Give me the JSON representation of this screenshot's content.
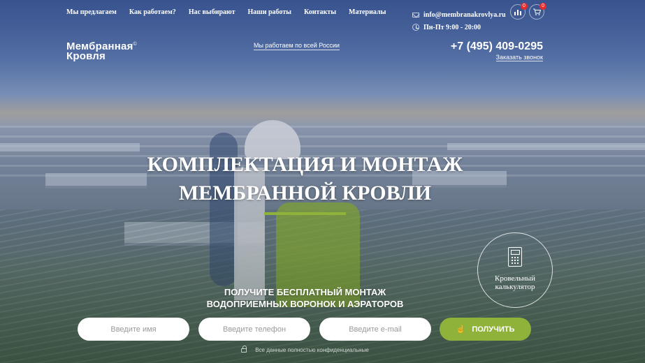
{
  "nav": {
    "items": [
      {
        "label": "Мы предлагаем"
      },
      {
        "label": "Как работаем?"
      },
      {
        "label": "Нас выбирают"
      },
      {
        "label": "Наши работы"
      },
      {
        "label": "Контакты"
      },
      {
        "label": "Материалы"
      }
    ]
  },
  "contact": {
    "email": "info@membranakrovlya.ru",
    "hours": "Пн-Пт 9:00 - 20:00"
  },
  "header_actions": {
    "compare_count": "0",
    "cart_count": "0"
  },
  "logo": {
    "line1": "Мембранная",
    "line2": "Кровля",
    "mark": "©"
  },
  "region_text": "Мы работаем по всей России",
  "phone": "+7 (495) 409-0295",
  "callback_label": "Заказать звонок",
  "hero": {
    "title_line1": "КОМПЛЕКТАЦИЯ И МОНТАЖ",
    "title_line2": "МЕМБРАННОЙ КРОВЛИ"
  },
  "calculator": {
    "line1": "Кровельный",
    "line2": "калькулятор"
  },
  "offer": {
    "line1": "ПОЛУЧИТЕ БЕСПЛАТНЫЙ МОНТАЖ",
    "line2": "ВОДОПРИЕМНЫХ ВОРОНОК И АЭРАТОРОВ"
  },
  "form": {
    "name_placeholder": "Введите имя",
    "phone_placeholder": "Введите телефон",
    "email_placeholder": "Введите e-mail",
    "submit_label": "ПОЛУЧИТЬ"
  },
  "privacy_text": "Все данные полностью конфиденциальные",
  "colors": {
    "accent": "#8fb33a",
    "badge": "#e52b2b"
  }
}
